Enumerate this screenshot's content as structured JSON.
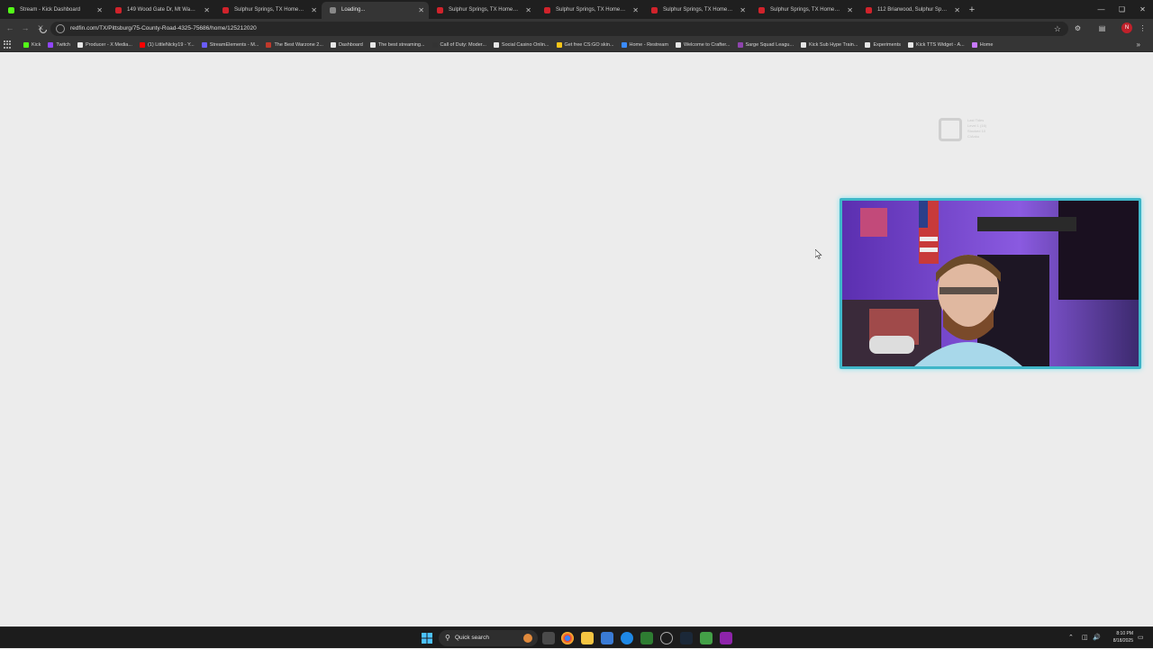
{
  "tabs": [
    {
      "title": "Stream - Kick Dashboard",
      "favicon_color": "#53fc18",
      "active": false
    },
    {
      "title": "149 Wood Gate Dr, Mt Washin...",
      "favicon_color": "#d0232b",
      "active": false
    },
    {
      "title": "Sulphur Springs, TX Homes for",
      "favicon_color": "#d0232b",
      "active": false
    },
    {
      "title": "Loading...",
      "favicon_color": "#888888",
      "active": true
    },
    {
      "title": "Sulphur Springs, TX Homes for",
      "favicon_color": "#d0232b",
      "active": false
    },
    {
      "title": "Sulphur Springs, TX Homes for",
      "favicon_color": "#d0232b",
      "active": false
    },
    {
      "title": "Sulphur Springs, TX Homes for",
      "favicon_color": "#d0232b",
      "active": false
    },
    {
      "title": "Sulphur Springs, TX Homes for",
      "favicon_color": "#d0232b",
      "active": false
    },
    {
      "title": "112 Briarwood, Sulphur Springs",
      "favicon_color": "#d0232b",
      "active": false
    }
  ],
  "toolbar": {
    "url": "redfin.com/TX/Pittsburg/75-County-Road-4325-75686/home/125212020",
    "profile_initial": "N"
  },
  "bookmarks": [
    {
      "label": "Kick",
      "color": "#53fc18"
    },
    {
      "label": "Twitch",
      "color": "#9146ff"
    },
    {
      "label": "Producer - X Media...",
      "color": "#e6e6e6"
    },
    {
      "label": "(1) LittleNicky19 - Y...",
      "color": "#ff0000"
    },
    {
      "label": "StreamElements - M...",
      "color": "#6a5cff"
    },
    {
      "label": "The Best Warzone 2...",
      "color": "#c0392b"
    },
    {
      "label": "Dashboard",
      "color": "#e6e6e6"
    },
    {
      "label": "The best streaming...",
      "color": "#e6e6e6"
    },
    {
      "label": "Call of Duty: Moder...",
      "color": "#333333"
    },
    {
      "label": "Social Casino Onlin...",
      "color": "#e6e6e6"
    },
    {
      "label": "Get free CS:GO skin...",
      "color": "#f5c518"
    },
    {
      "label": "Home - Restream",
      "color": "#3a8bff"
    },
    {
      "label": "Welcome to Crafter...",
      "color": "#e6e6e6"
    },
    {
      "label": "Sarge Squad Leagu...",
      "color": "#8e44ad"
    },
    {
      "label": "Kick Sub Hype Train...",
      "color": "#e6e6e6"
    },
    {
      "label": "Experiments",
      "color": "#e6e6e6"
    },
    {
      "label": "Kick TTS Widget - A...",
      "color": "#e6e6e6"
    },
    {
      "label": "Home",
      "color": "#c879ff"
    }
  ],
  "overlay": {
    "ghost_text": "Last Tides\nLevel 1 (16)\nStocked 10\nC/Anku"
  },
  "taskbar": {
    "search_label": "Quick search",
    "time": "8:10 PM",
    "date": "8/18/2025"
  }
}
